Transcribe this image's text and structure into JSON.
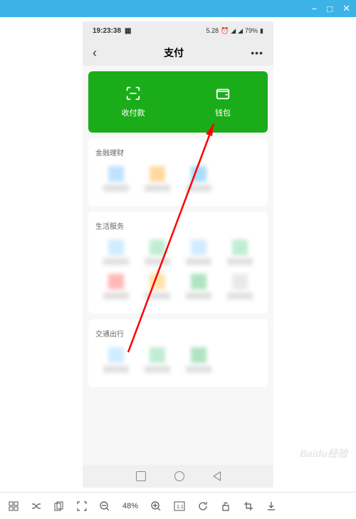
{
  "window": {
    "minimize": "−",
    "maximize": "□",
    "close": "✕"
  },
  "phone": {
    "status": {
      "time": "19:23:38",
      "date": "5.28",
      "battery_pct": "79%"
    },
    "nav": {
      "back": "‹",
      "title": "支付",
      "more": "•••"
    },
    "green_card": {
      "pay_label": "收付款",
      "wallet_label": "钱包"
    },
    "sections": [
      {
        "title": "金融理财",
        "item_count": 3
      },
      {
        "title": "生活服务",
        "item_count": 8
      },
      {
        "title": "交通出行",
        "item_count": 3
      }
    ]
  },
  "toolbar": {
    "zoom": "48%"
  },
  "watermark": "Baidu经验",
  "icon_colors": {
    "section1": [
      "#a5d6ff",
      "#ffc97a",
      "#87cefa"
    ],
    "section2": [
      "#bde4ff",
      "#a5e6c0",
      "#bde4ff",
      "#a5e6c0",
      "#ff9b9b",
      "#ffd78a",
      "#8fd9a8",
      "#e0e0e0"
    ],
    "section3": [
      "#bde4ff",
      "#a5e6c0",
      "#8fd9a8"
    ]
  }
}
